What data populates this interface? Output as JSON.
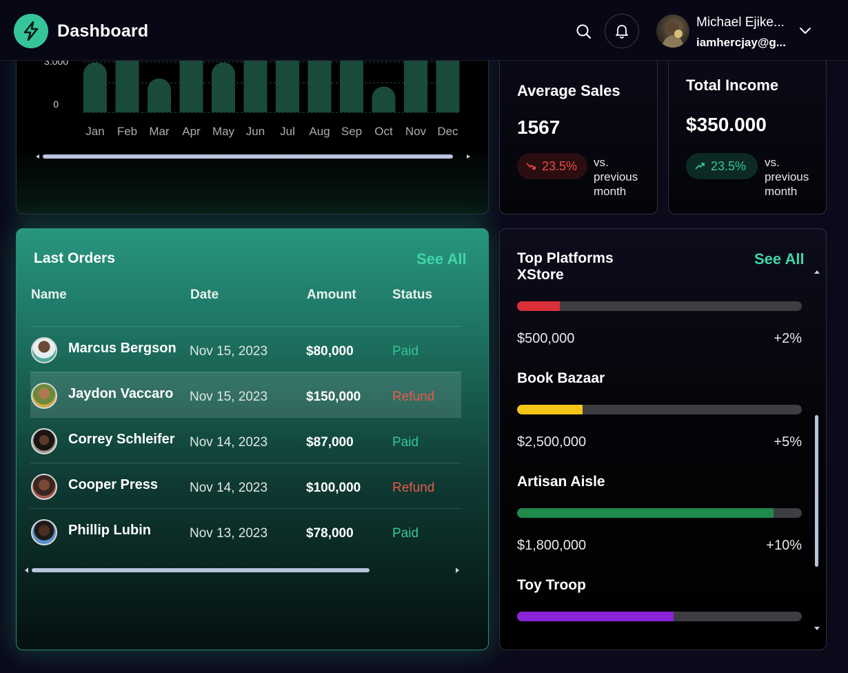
{
  "header": {
    "title": "Dashboard",
    "user_name": "Michael Ejike...",
    "user_email": "iamhercjay@g..."
  },
  "chart_data": {
    "type": "bar",
    "categories": [
      "Jan",
      "Feb",
      "Mar",
      "Apr",
      "May",
      "Jun",
      "Jul",
      "Aug",
      "Sep",
      "Oct",
      "Nov",
      "Dec"
    ],
    "values": [
      5000,
      6200,
      3400,
      6200,
      5000,
      6200,
      6200,
      6200,
      6200,
      2600,
      6200,
      6200
    ],
    "y_tick_labels": [
      "3.000",
      "0"
    ],
    "bar_color": "#1a4a3a",
    "grid": true
  },
  "stats": {
    "avg_title": "Average Sales",
    "avg_value": "1567",
    "avg_change": "23.5%",
    "avg_vs": [
      "vs.",
      "previous",
      "month"
    ],
    "income_title": "Total Income",
    "income_value": "$350.000",
    "income_change": "23.5%",
    "income_vs": [
      "vs.",
      "previous",
      "month"
    ]
  },
  "orders": {
    "title": "Last Orders",
    "see_all": "See All",
    "headers": [
      "Name",
      "Date",
      "Amount",
      "Status"
    ],
    "rows": [
      {
        "name": "Marcus Bergson",
        "date": "Nov 15, 2023",
        "amount": "$80,000",
        "status": "Paid"
      },
      {
        "name": "Jaydon Vaccaro",
        "date": "Nov 15, 2023",
        "amount": "$150,000",
        "status": "Refund"
      },
      {
        "name": "Correy Schleifer",
        "date": "Nov 14, 2023",
        "amount": "$87,000",
        "status": "Paid"
      },
      {
        "name": "Cooper Press",
        "date": "Nov 14, 2023",
        "amount": "$100,000",
        "status": "Refund"
      },
      {
        "name": "Phillip Lubin",
        "date": "Nov 13, 2023",
        "amount": "$78,000",
        "status": "Paid"
      }
    ]
  },
  "platforms": {
    "title_line1": "Top Platforms",
    "title_line2": "XStore",
    "see_all": "See All",
    "items": [
      {
        "name": "XStore",
        "amount": "$500,000",
        "change": "+2%",
        "progress": 0.15,
        "color": "#d9303a"
      },
      {
        "name": "Book Bazaar",
        "amount": "$2,500,000",
        "change": "+5%",
        "progress": 0.23,
        "color": "#f5c518"
      },
      {
        "name": "Artisan Aisle",
        "amount": "$1,800,000",
        "change": "+10%",
        "progress": 0.9,
        "color": "#1f8a4c"
      },
      {
        "name": "Toy Troop",
        "amount": "",
        "change": "",
        "progress": 0.55,
        "color": "#8a24d6"
      }
    ]
  },
  "colors": {
    "accent": "#36c59a",
    "paid": "#36c59a",
    "refund": "#e85a4a",
    "negative": "#ea4a4a"
  }
}
